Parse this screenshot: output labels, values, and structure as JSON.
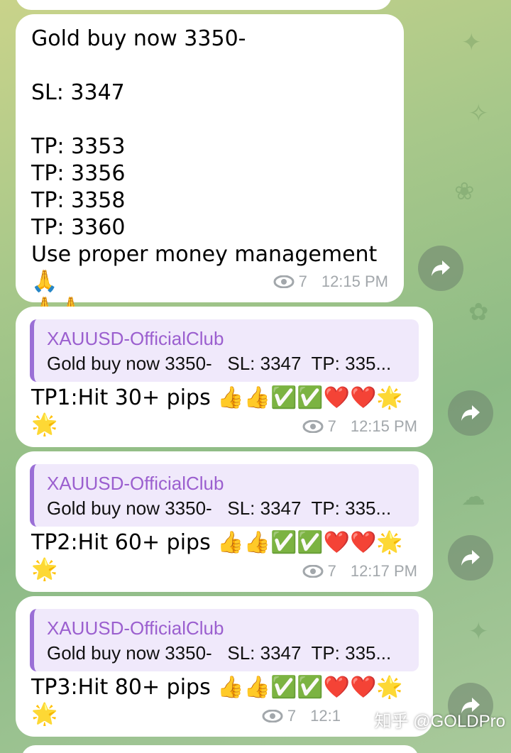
{
  "messages": [
    {
      "text": "Gold buy now 3350-\n\nSL: 3347\n\nTP: 3353\nTP: 3356\nTP: 3358\nTP: 3360\nUse proper money management 🙏\n🙏🙏",
      "views": "7",
      "time": "12:15 PM"
    },
    {
      "reply_name": "XAUUSD-OfficialClub",
      "reply_text": "Gold buy now 3350-   SL: 3347  TP: 335...",
      "text": "TP1:Hit 30+ pips 👍👍✅✅❤️❤️🌟\n🌟",
      "views": "7",
      "time": "12:15 PM"
    },
    {
      "reply_name": "XAUUSD-OfficialClub",
      "reply_text": "Gold buy now 3350-   SL: 3347  TP: 335...",
      "text": "TP2:Hit 60+ pips 👍👍✅✅❤️❤️🌟\n🌟",
      "views": "7",
      "time": "12:17 PM"
    },
    {
      "reply_name": "XAUUSD-OfficialClub",
      "reply_text": "Gold buy now 3350-   SL: 3347  TP: 335...",
      "text": "TP3:Hit 80+ pips 👍👍✅✅❤️❤️🌟\n🌟",
      "views": "7",
      "time": "12:1"
    }
  ],
  "watermark": "知乎 @GOLDPro",
  "colors": {
    "reply_accent": "#9a6fd6",
    "reply_name": "#9b5fcf",
    "meta": "#a2a7ab"
  },
  "icons": [
    "eye-icon",
    "forward-icon"
  ]
}
